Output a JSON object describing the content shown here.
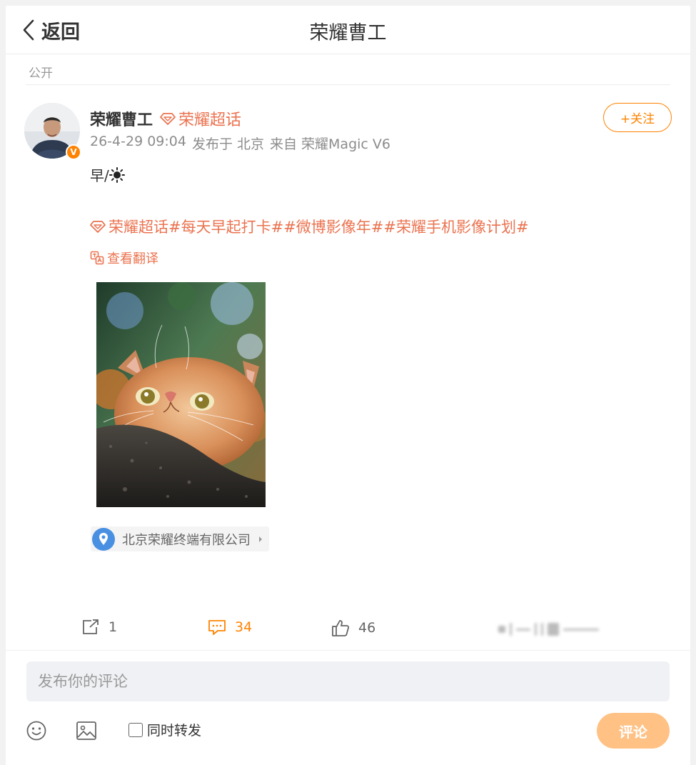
{
  "header": {
    "back_label": "返回",
    "title": "荣耀曹工"
  },
  "visibility": "公开",
  "author": {
    "name": "荣耀曹工",
    "verified_mark": "V",
    "super_topic_tag": "荣耀超话",
    "timestamp": "26-4-29 09:04",
    "location_prefix": "发布于 北京",
    "source": "来自 荣耀Magic V6",
    "follow_label": "+关注"
  },
  "post": {
    "text": "早/",
    "topics": [
      "荣耀超话",
      "#每天早起打卡#",
      "#微博影像年#",
      "#荣耀手机影像计划#"
    ],
    "translate_label": "查看翻译",
    "location": "北京荣耀终端有限公司"
  },
  "actions": {
    "repost_count": "1",
    "comment_count": "34",
    "like_count": "46"
  },
  "composer": {
    "placeholder": "发布你的评论",
    "repost_label": "同时转发",
    "submit_label": "评论"
  },
  "colors": {
    "accent": "#ff8200",
    "topic": "#eb7350",
    "submit_disabled": "#ffc184"
  }
}
